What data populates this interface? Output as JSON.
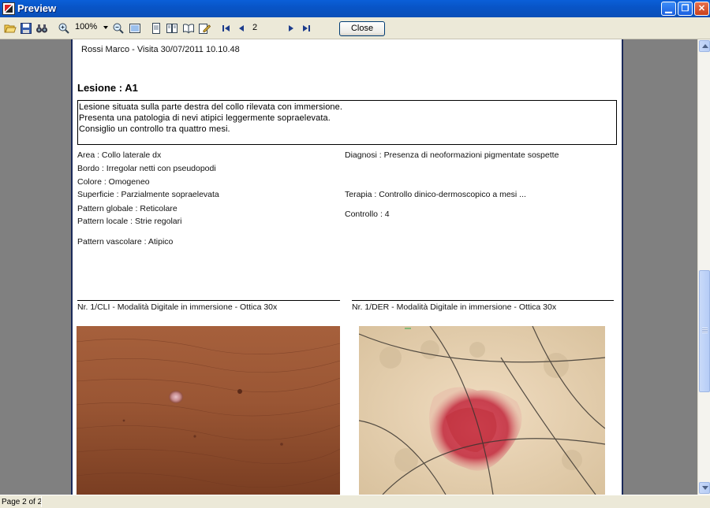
{
  "window": {
    "title": "Preview"
  },
  "toolbar": {
    "icons": [
      "open-folder-icon",
      "save-disk-icon",
      "find-binoculars-icon",
      "zoom-in-icon",
      "zoom-out-icon",
      "full-page-icon",
      "one-page-icon",
      "two-pages-icon",
      "book-icon",
      "edit-icon",
      "first-page-icon",
      "previous-page-icon",
      "next-page-icon",
      "last-page-icon"
    ],
    "zoom_value": "100%",
    "page_number": "2",
    "close_label": "Close"
  },
  "report": {
    "header": "Rossi Marco - Visita 30/07/2011 10.10.48",
    "lesion_title": "Lesione : A1",
    "description": [
      "Lesione situata sulla parte destra del collo rilevata con immersione.",
      "Presenta una patologia di nevi atipici leggermente sopraelevata.",
      "Consiglio un controllo tra quattro mesi."
    ],
    "left_fields": {
      "area": "Area : Collo laterale dx",
      "bordo": "Bordo : Irregolar netti con pseudopodi",
      "colore": "Colore : Omogeneo",
      "superficie": "Superficie : Parzialmente sopraelevata",
      "pattern_globale": "Pattern globale : Reticolare",
      "pattern_locale": "Pattern locale : Strie regolari",
      "pattern_vascolare": "Pattern vascolare : Atipico"
    },
    "right_fields": {
      "diagnosi": "Diagnosi : Presenza di neoformazioni pigmentate sospette",
      "terapia": "Terapia : Controllo dinico-dermoscopico a mesi ...",
      "controllo": "Controllo : 4"
    },
    "images": [
      {
        "caption": "Nr. 1/CLI - Modalità Digitale in immersione - Ottica 30x"
      },
      {
        "caption": "Nr. 1/DER - Modalità Digitale in immersione - Ottica 30x"
      }
    ]
  },
  "status": {
    "page_text": "Page 2 of 2"
  },
  "colors": {
    "titlebar": "#0a5fd8",
    "viewer_bg": "#808080",
    "page_border": "#1b2a5a"
  }
}
